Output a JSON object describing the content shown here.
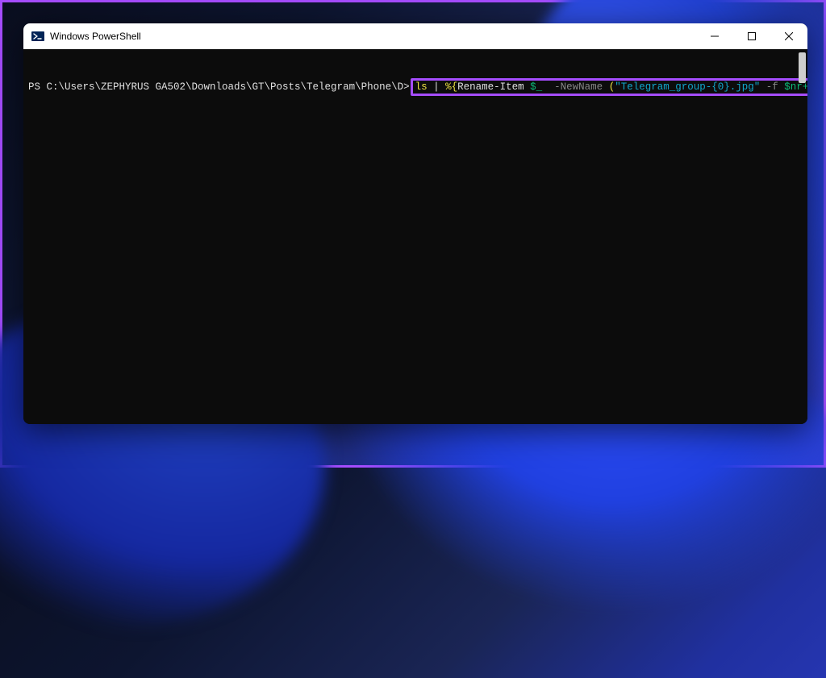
{
  "window": {
    "title": "Windows PowerShell"
  },
  "prompt": {
    "path": "PS C:\\Users\\ZEPHYRUS GA502\\Downloads\\GT\\Posts\\Telegram\\Phone\\D>"
  },
  "command": {
    "ls": "ls",
    "pipe": " | ",
    "percent_brace": "%{",
    "rename": "Rename-Item ",
    "under_var": "$_",
    "space1": "  ",
    "newname_param": "-NewName ",
    "paren_open": "(",
    "str_q1": "\"Telegram_group-{0}.jpg\"",
    "space2": " ",
    "f_op": "-f ",
    "nr_var": "$nr++",
    "paren_close": ")",
    "brace_close": "}",
    "cursor": "_"
  }
}
